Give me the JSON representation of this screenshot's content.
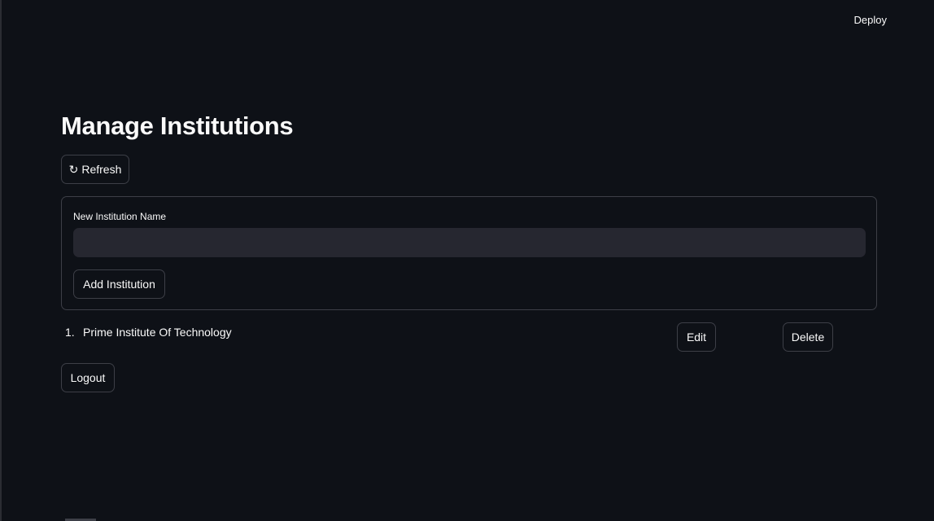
{
  "header": {
    "deploy_label": "Deploy"
  },
  "page": {
    "title": "Manage Institutions"
  },
  "toolbar": {
    "refresh_icon": "↻",
    "refresh_label": "Refresh"
  },
  "form": {
    "label": "New Institution Name",
    "input_value": "",
    "add_label": "Add Institution"
  },
  "institutions": [
    {
      "number": "1.",
      "name": "Prime Institute Of Technology",
      "edit_label": "Edit",
      "delete_label": "Delete"
    }
  ],
  "footer": {
    "logout_label": "Logout"
  }
}
